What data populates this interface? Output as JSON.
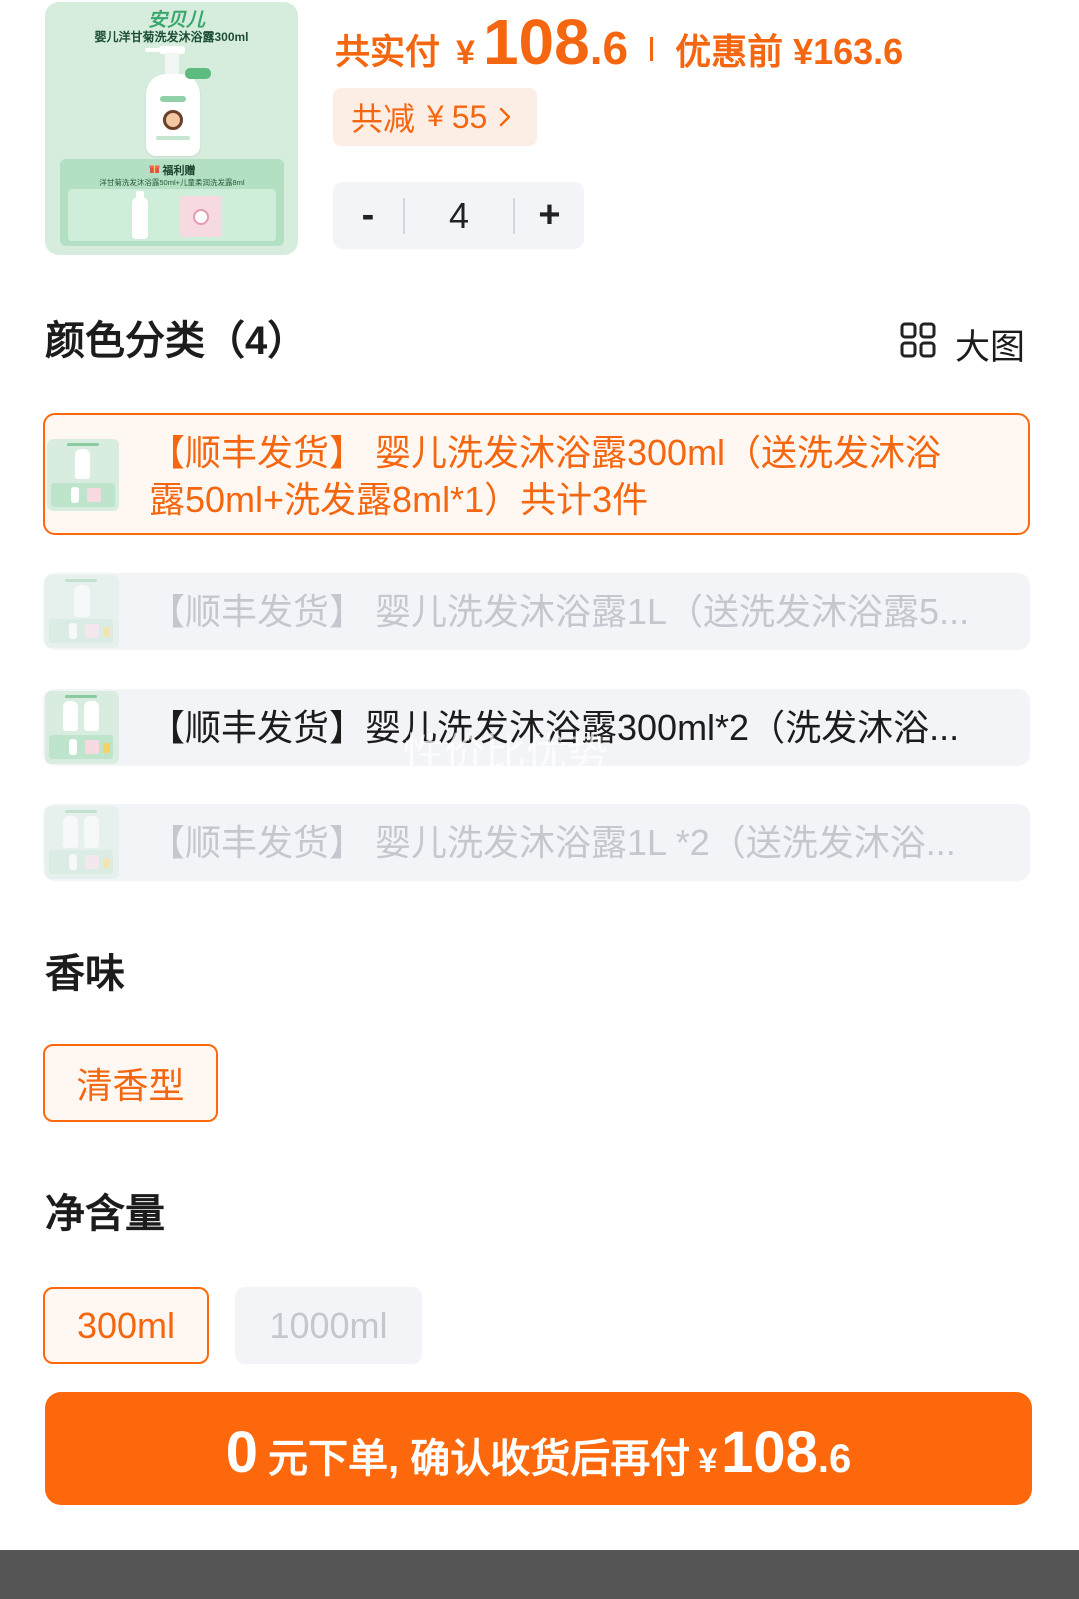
{
  "product": {
    "image": {
      "brand_logo": "安贝儿",
      "title": "婴儿洋甘菊洗发沐浴露300ml",
      "gift_label": "福利赠",
      "gift_detail": "洋甘菊洗发沐浴露50ml+儿童柔润洗发露8ml",
      "gift_icon": "gift-icon"
    },
    "price": {
      "label": "共实付",
      "currency": "¥",
      "integer": "108",
      "decimal": ".6",
      "original": "优惠前 ¥163.6"
    },
    "discount": {
      "label": "共减",
      "currency": "¥",
      "amount": "55",
      "icon": "chevron-right-icon"
    },
    "quantity": {
      "minus": "-",
      "value": "4",
      "plus": "+"
    }
  },
  "color_section": {
    "title": "颜色分类（4）",
    "view_toggle": {
      "label": "大图",
      "icon": "grid-view-icon"
    },
    "options": [
      {
        "label": "【顺丰发货】 婴儿洗发沐浴露300ml（送洗发沐浴露50ml+洗发露8ml*1）共计3件",
        "selected": true,
        "disabled": false
      },
      {
        "label": "【顺丰发货】 婴儿洗发沐浴露1L（送洗发沐浴露5...",
        "selected": false,
        "disabled": true
      },
      {
        "label": "【顺丰发货】婴儿洗发沐浴露300ml*2（洗发沐浴...",
        "selected": false,
        "disabled": false
      },
      {
        "label": "【顺丰发货】 婴儿洗发沐浴露1L *2（送洗发沐浴...",
        "selected": false,
        "disabled": true
      }
    ]
  },
  "scent_section": {
    "title": "香味",
    "options": [
      {
        "label": "清香型",
        "selected": true,
        "disabled": false
      }
    ]
  },
  "volume_section": {
    "title": "净含量",
    "options": [
      {
        "label": "300ml",
        "selected": true,
        "disabled": false
      },
      {
        "label": "1000ml",
        "selected": false,
        "disabled": true
      }
    ]
  },
  "watermark": "性价比优势",
  "submit_button": {
    "amount": "0",
    "text": "元下单, 确认收货后再付",
    "currency": "¥",
    "integer": "108",
    "decimal": ".6"
  },
  "colors": {
    "accent": "#fe680c",
    "accent_text": "#f4660f",
    "selected_bg": "#fff8f2",
    "discount_bg": "#fdeee5",
    "option_bg": "#f2f4f7",
    "disabled_text": "#c4c8ce",
    "text": "#1c1c1c",
    "bottom_bar": "#565656"
  }
}
